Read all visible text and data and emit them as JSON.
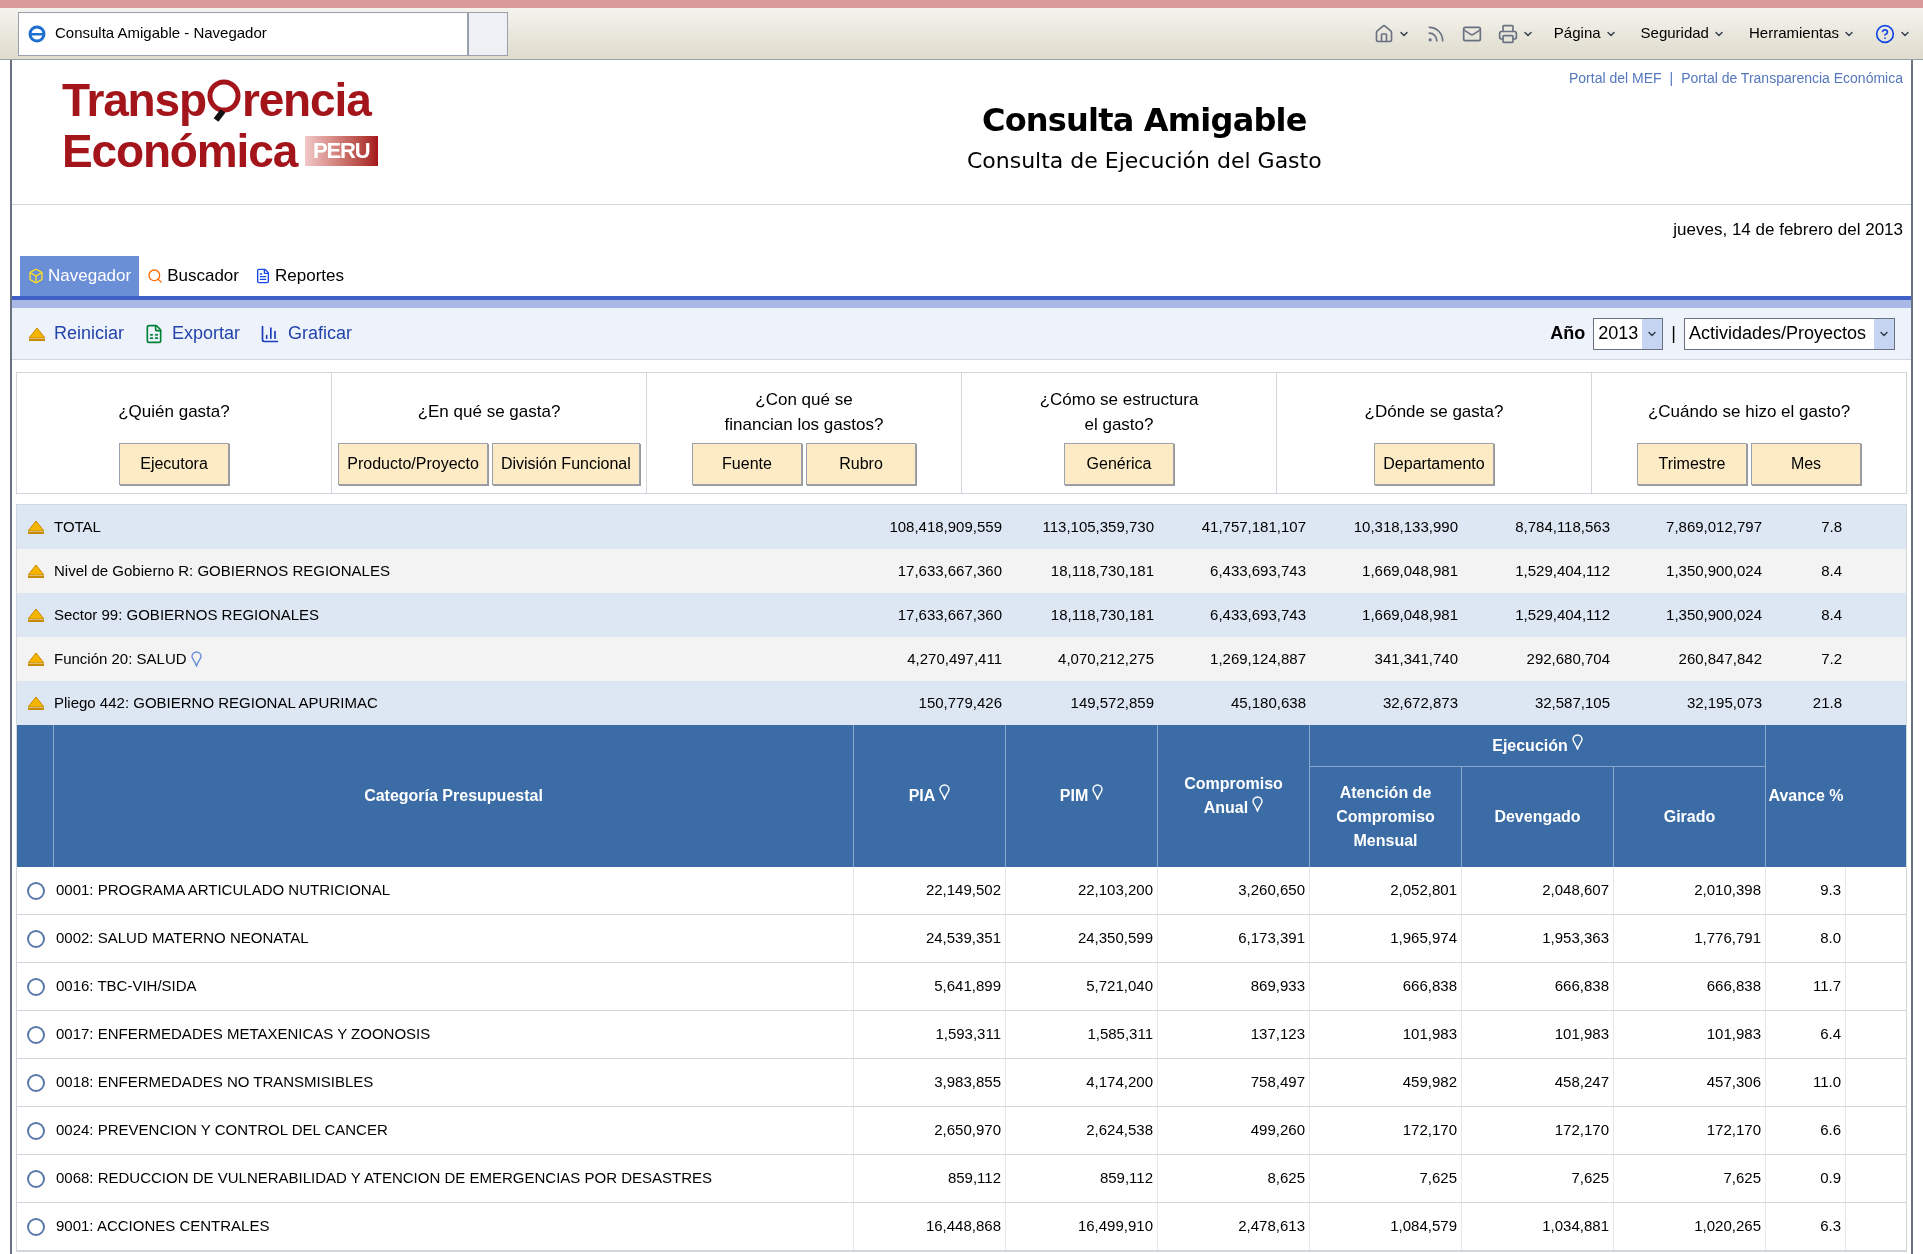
{
  "browser": {
    "title": "Consulta Amigable - Navegador",
    "tools": [
      {
        "kind": "home"
      },
      {
        "kind": "feed"
      },
      {
        "kind": "mail"
      },
      {
        "kind": "print"
      },
      {
        "kind": "menu",
        "label": "Página"
      },
      {
        "kind": "menu",
        "label": "Seguridad"
      },
      {
        "kind": "menu",
        "label": "Herramientas"
      },
      {
        "kind": "help"
      }
    ]
  },
  "header": {
    "logo_line1": [
      "Transp",
      "rencia"
    ],
    "logo_line2": "Económica",
    "logo_badge": "PERU",
    "title": "Consulta Amigable",
    "subtitle": "Consulta de Ejecución del Gasto",
    "links": [
      {
        "label": "Portal del MEF"
      },
      {
        "label": "Portal de Transparencia Económica"
      }
    ],
    "separator": "|",
    "date": "jueves, 14 de febrero del 2013"
  },
  "tabs": [
    {
      "label": "Navegador",
      "kind": "navigator",
      "selected": true
    },
    {
      "label": "Buscador",
      "kind": "search",
      "selected": false
    },
    {
      "label": "Reportes",
      "kind": "report",
      "selected": false
    }
  ],
  "actions": [
    {
      "label": "Reiniciar",
      "kind": "reset"
    },
    {
      "label": "Exportar",
      "kind": "excel"
    },
    {
      "label": "Graficar",
      "kind": "chart"
    }
  ],
  "year": {
    "label": "Año",
    "value": "2013"
  },
  "separator": "|",
  "scope": {
    "value": "Actividades/Proyectos"
  },
  "filters": [
    {
      "question": "¿Quién gasta?",
      "buttons": [
        "Ejecutora"
      ]
    },
    {
      "question": "¿En qué se gasta?",
      "buttons": [
        "Producto/Proyecto",
        "División Funcional"
      ]
    },
    {
      "question": "¿Con qué se\nfinancian los gastos?",
      "buttons": [
        "Fuente",
        "Rubro"
      ]
    },
    {
      "question": "¿Cómo se estructura\nel gasto?",
      "buttons": [
        "Genérica"
      ]
    },
    {
      "question": "¿Dónde se gasta?",
      "buttons": [
        "Departamento"
      ]
    },
    {
      "question": "¿Cuándo se hizo el gasto?",
      "buttons": [
        "Trimestre",
        "Mes"
      ]
    }
  ],
  "summary": [
    {
      "label": "TOTAL",
      "info_icon": false,
      "values": [
        "108,418,909,559",
        "113,105,359,730",
        "41,757,181,107",
        "10,318,133,990",
        "8,784,118,563",
        "7,869,012,797",
        "7.8"
      ]
    },
    {
      "label": "Nivel de Gobierno R: GOBIERNOS REGIONALES",
      "info_icon": false,
      "values": [
        "17,633,667,360",
        "18,118,730,181",
        "6,433,693,743",
        "1,669,048,981",
        "1,529,404,112",
        "1,350,900,024",
        "8.4"
      ]
    },
    {
      "label": "Sector 99: GOBIERNOS REGIONALES",
      "info_icon": false,
      "values": [
        "17,633,667,360",
        "18,118,730,181",
        "6,433,693,743",
        "1,669,048,981",
        "1,529,404,112",
        "1,350,900,024",
        "8.4"
      ]
    },
    {
      "label": "Función 20: SALUD",
      "info_icon": true,
      "values": [
        "4,270,497,411",
        "4,070,212,275",
        "1,269,124,887",
        "341,341,740",
        "292,680,704",
        "260,847,842",
        "7.2"
      ]
    },
    {
      "label": "Pliego 442: GOBIERNO REGIONAL APURIMAC",
      "info_icon": false,
      "values": [
        "150,779,426",
        "149,572,859",
        "45,180,638",
        "32,672,873",
        "32,587,105",
        "32,195,073",
        "21.8"
      ]
    }
  ],
  "table": {
    "columns": [
      {
        "label": "Categoría Presupuestal",
        "info_icon": false
      },
      {
        "label": "PIA",
        "info_icon": true
      },
      {
        "label": "PIM",
        "info_icon": true
      },
      {
        "label": "Compromiso Anual",
        "info_icon": true
      },
      {
        "label": "Atención de Compromiso Mensual",
        "info_icon": false
      },
      {
        "label": "Devengado",
        "info_icon": false
      },
      {
        "label": "Girado",
        "info_icon": false
      },
      {
        "label": "Avance %",
        "info_icon": false
      }
    ],
    "group": {
      "label": "Ejecución",
      "info_icon": true
    },
    "rows": [
      {
        "selected": false,
        "cells": [
          "0001: PROGRAMA ARTICULADO NUTRICIONAL",
          "22,149,502",
          "22,103,200",
          "3,260,650",
          "2,052,801",
          "2,048,607",
          "2,010,398",
          "9.3"
        ]
      },
      {
        "selected": false,
        "cells": [
          "0002: SALUD MATERNO NEONATAL",
          "24,539,351",
          "24,350,599",
          "6,173,391",
          "1,965,974",
          "1,953,363",
          "1,776,791",
          "8.0"
        ]
      },
      {
        "selected": false,
        "cells": [
          "0016: TBC-VIH/SIDA",
          "5,641,899",
          "5,721,040",
          "869,933",
          "666,838",
          "666,838",
          "666,838",
          "11.7"
        ]
      },
      {
        "selected": false,
        "cells": [
          "0017: ENFERMEDADES METAXENICAS Y ZOONOSIS",
          "1,593,311",
          "1,585,311",
          "137,123",
          "101,983",
          "101,983",
          "101,983",
          "6.4"
        ]
      },
      {
        "selected": false,
        "cells": [
          "0018: ENFERMEDADES NO TRANSMISIBLES",
          "3,983,855",
          "4,174,200",
          "758,497",
          "459,982",
          "458,247",
          "457,306",
          "11.0"
        ]
      },
      {
        "selected": false,
        "cells": [
          "0024: PREVENCION Y CONTROL DEL CANCER",
          "2,650,970",
          "2,624,538",
          "499,260",
          "172,170",
          "172,170",
          "172,170",
          "6.6"
        ]
      },
      {
        "selected": false,
        "cells": [
          "0068: REDUCCION DE VULNERABILIDAD Y ATENCION DE EMERGENCIAS POR DESASTRES",
          "859,112",
          "859,112",
          "8,625",
          "7,625",
          "7,625",
          "7,625",
          "0.9"
        ]
      },
      {
        "selected": false,
        "cells": [
          "9001: ACCIONES CENTRALES",
          "16,448,868",
          "16,499,910",
          "2,478,613",
          "1,084,579",
          "1,034,881",
          "1,020,265",
          "6.3"
        ]
      }
    ]
  }
}
